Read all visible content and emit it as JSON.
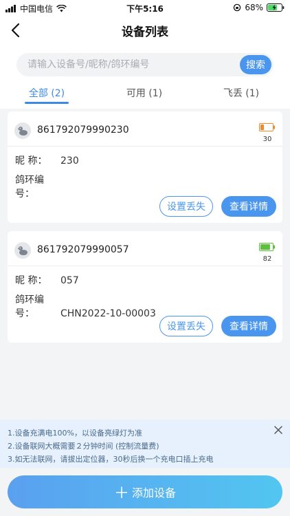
{
  "status_bar": {
    "carrier": "中国电信",
    "time": "下午5:16",
    "battery_percent": "68%"
  },
  "nav": {
    "title": "设备列表"
  },
  "search": {
    "placeholder": "请输入设备号/昵称/鸽环编号",
    "button_label": "搜索"
  },
  "tabs": [
    {
      "label": "全部 (2)",
      "active": true
    },
    {
      "label": "可用 (1)",
      "active": false
    },
    {
      "label": "飞丢 (1)",
      "active": false
    }
  ],
  "devices": [
    {
      "imei": "861792079990230",
      "battery": "30",
      "battery_level": 0.3,
      "battery_color": "#f08a2c",
      "nickname_label": "昵      称：",
      "nickname": "230",
      "ring_label": "鸽环编号：",
      "ring": "",
      "lost_button": "设置丢失",
      "detail_button": "查看详情"
    },
    {
      "imei": "861792079990057",
      "battery": "82",
      "battery_level": 0.82,
      "battery_color": "#5ac23a",
      "nickname_label": "昵      称：",
      "nickname": "057",
      "ring_label": "鸽环编号：",
      "ring": "CHN2022-10-00003",
      "lost_button": "设置丢失",
      "detail_button": "查看详情"
    }
  ],
  "notice": {
    "lines": [
      "1.设备充满电100%，以设备亮绿灯为准",
      "2.设备联网大概需要２分钟时间 (控制流量费)",
      "3.如无法联网，请拔出定位器，30秒后换一个充电口插上充电"
    ]
  },
  "add_button": {
    "label": "添加设备"
  },
  "colors": {
    "accent": "#4a96ee",
    "notice_bg": "#e6f1fd"
  }
}
